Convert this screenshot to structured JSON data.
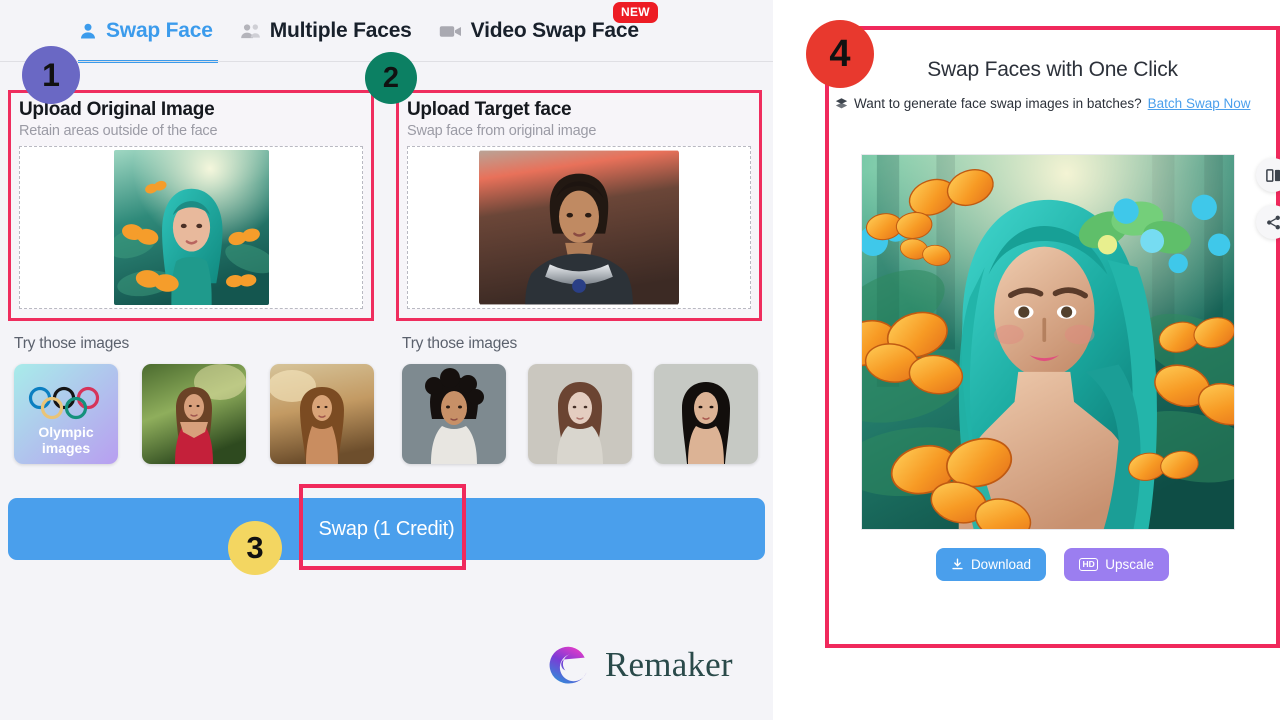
{
  "app": {
    "brand_name": "Remaker",
    "accent_blue": "#4a9fec",
    "annotation_pink": "#f0295c"
  },
  "tabs": [
    {
      "label": "Swap Face",
      "icon": "person-icon",
      "active": true
    },
    {
      "label": "Multiple Faces",
      "icon": "people-icon",
      "active": false
    },
    {
      "label": "Video Swap Face",
      "icon": "video-camera-icon",
      "active": false
    }
  ],
  "new_badge": "NEW",
  "upload_original": {
    "title": "Upload Original Image",
    "subtitle": "Retain areas outside of the face",
    "try_label": "Try those images",
    "samples": [
      {
        "name": "olympic-images",
        "line1": "Olympic",
        "line2": "images"
      },
      {
        "name": "woman-red-top-sample"
      },
      {
        "name": "woman-sunset-sample"
      }
    ]
  },
  "upload_target": {
    "title": "Upload Target face",
    "subtitle": "Swap face from original image",
    "try_label": "Try those images",
    "samples": [
      {
        "name": "man-curly-hair-sample"
      },
      {
        "name": "woman-pale-sample"
      },
      {
        "name": "woman-asian-sample"
      }
    ]
  },
  "swap": {
    "button_label": "Swap (1 Credit)"
  },
  "result": {
    "title": "Swap Faces with One Click",
    "batch_icon": "layers-icon",
    "batch_text": "Want to generate face swap images in batches?",
    "batch_link": "Batch Swap Now",
    "download_label": "Download",
    "download_icon": "download-icon",
    "upscale_label": "Upscale",
    "upscale_icon": "hd-icon",
    "hd_text": "HD",
    "side_icons": [
      {
        "name": "compare-split-icon"
      },
      {
        "name": "share-icon"
      }
    ]
  },
  "step_badges": [
    {
      "number": "1",
      "color": "#6a68c4"
    },
    {
      "number": "2",
      "color": "#0c8063"
    },
    {
      "number": "3",
      "color": "#f3d661"
    },
    {
      "number": "4",
      "color": "#e8392e"
    }
  ]
}
